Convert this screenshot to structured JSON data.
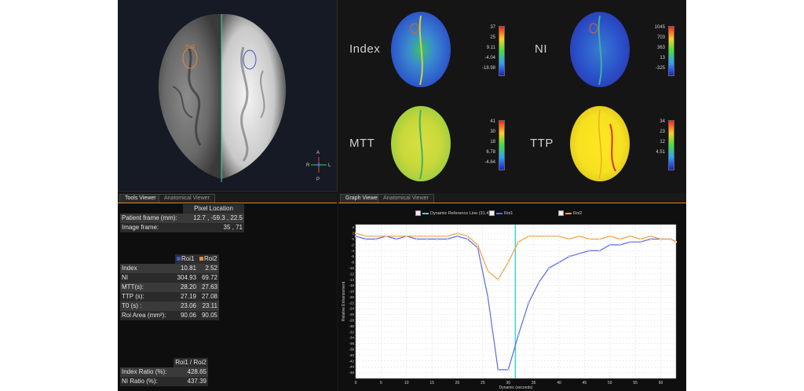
{
  "brain_viewer": {
    "roi1_label": "Roi2",
    "roi2_label": "Roi1",
    "orient": {
      "top": "A",
      "bottom": "P",
      "left": "R",
      "right": "L"
    },
    "colors": {
      "roi_orange": "#e08a3c",
      "roi_blue": "#3a56d0",
      "crosshair": "#3bd6a8"
    }
  },
  "maps": [
    {
      "label": "Index",
      "ticks": [
        "37",
        "25",
        "9.11",
        "-4.04",
        "-18.98"
      ],
      "palette": "blue"
    },
    {
      "label": "NI",
      "ticks": [
        "1045",
        "703",
        "363",
        "13",
        "-325"
      ],
      "palette": "blue"
    },
    {
      "label": "MTT",
      "ticks": [
        "41",
        "30",
        "18",
        "6.78",
        "-4.64"
      ],
      "palette": "yellow"
    },
    {
      "label": "TTP",
      "ticks": [
        "34",
        "23",
        "12",
        "4.51"
      ],
      "palette": "yellow"
    }
  ],
  "tools": {
    "tabs": [
      "Tools Viewer",
      "Anatomical Viewer"
    ],
    "pixel_location_header": "Pixel Location",
    "patient_frame_label": "Patient frame (mm):",
    "patient_frame_value": "12.7 , -59.3 , 22.5",
    "image_frame_label": "Image frame:",
    "image_frame_value": "35 , 71",
    "roi_table": {
      "headers": [
        "Roi1",
        "Roi2"
      ],
      "header_colors": [
        "#3a56d0",
        "#e08a3c"
      ],
      "rows": [
        {
          "label": "Index",
          "v1": "10.81",
          "v2": "2.52"
        },
        {
          "label": "NI",
          "v1": "304.93",
          "v2": "69.72"
        },
        {
          "label": "MTT(s):",
          "v1": "28.20",
          "v2": "27.63"
        },
        {
          "label": "TTP (s):",
          "v1": "27.19",
          "v2": "27.08"
        },
        {
          "label": "T0 (s) :",
          "v1": "23.06",
          "v2": "23.11"
        },
        {
          "label": "Roi Area (mm²):",
          "v1": "90.06",
          "v2": "90.05"
        }
      ]
    },
    "ratio_table": {
      "header": "Roi1 / Roi2",
      "rows": [
        {
          "label": "Index Ratio (%):",
          "value": "428.65"
        },
        {
          "label": "NI Ratio (%):",
          "value": "437.39"
        }
      ]
    }
  },
  "graph": {
    "tabs": [
      "Graph Viewer",
      "Anatomical Viewer"
    ],
    "legend": [
      {
        "label": "Dynamic Reference Line (31.4)",
        "color": "#3bd6d6"
      },
      {
        "label": "Roi1",
        "color": "#5a6ae8"
      },
      {
        "label": "Roi2",
        "color": "#f0a040"
      }
    ],
    "x_axis_title": "Dynamic (seconds)",
    "y_axis_title": "Relative Enhancement"
  },
  "chart_data": {
    "type": "line",
    "xlabel": "Dynamic (seconds)",
    "ylabel": "Relative Enhancement",
    "xlim": [
      0,
      63
    ],
    "ylim": [
      -48,
      5
    ],
    "x_ticks": [
      0,
      5,
      10,
      15,
      20,
      25,
      30,
      35,
      40,
      45,
      50,
      55,
      60
    ],
    "y_ticks": [
      4,
      2,
      0,
      -2,
      -4,
      -6,
      -8,
      -10,
      -12,
      -14,
      -16,
      -18,
      -20,
      -22,
      -24,
      -26,
      -28,
      -30,
      -32,
      -34,
      -36,
      -38,
      -40,
      -42,
      -44,
      -46
    ],
    "reference_x": 31.4,
    "series": [
      {
        "name": "Roi1",
        "color": "#5a6ae8",
        "x": [
          0,
          2,
          4,
          6,
          8,
          10,
          12,
          14,
          16,
          18,
          20,
          22,
          24,
          26,
          28,
          30,
          32,
          34,
          36,
          38,
          40,
          42,
          44,
          46,
          48,
          50,
          52,
          54,
          56,
          58,
          60,
          62,
          63
        ],
        "y": [
          1,
          0,
          0,
          1,
          0,
          1,
          0,
          0,
          0,
          0,
          1,
          0,
          -3,
          -20,
          -45,
          -45,
          -33,
          -22,
          -15,
          -10,
          -8,
          -6,
          -5,
          -4,
          -4,
          -2,
          -2,
          -1,
          -1,
          0,
          0,
          0,
          -1
        ]
      },
      {
        "name": "Roi2",
        "color": "#f0a040",
        "x": [
          0,
          2,
          4,
          6,
          8,
          10,
          12,
          14,
          16,
          18,
          20,
          22,
          24,
          26,
          28,
          30,
          32,
          34,
          36,
          38,
          40,
          42,
          44,
          46,
          48,
          50,
          52,
          54,
          56,
          58,
          60,
          62,
          63
        ],
        "y": [
          2,
          1,
          1,
          1,
          1,
          1,
          1,
          1,
          1,
          1,
          2,
          1,
          -2,
          -11,
          -14,
          -8,
          -1,
          1,
          1,
          1,
          1,
          0,
          1,
          0,
          0,
          1,
          0,
          1,
          0,
          1,
          0,
          0,
          -1
        ]
      }
    ]
  }
}
